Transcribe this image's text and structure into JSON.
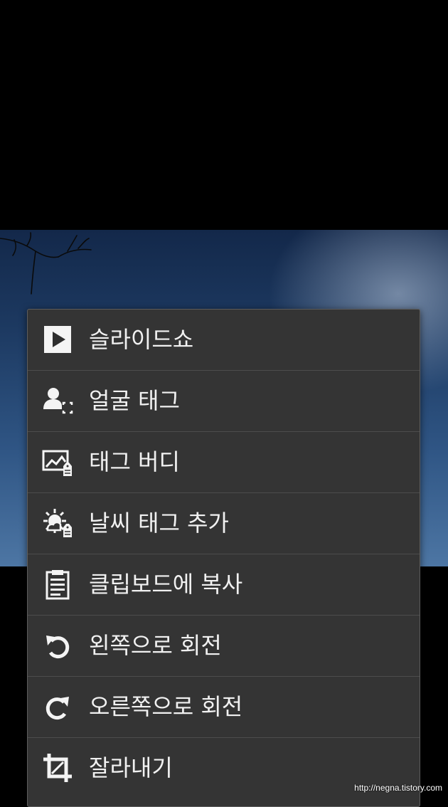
{
  "photo": {
    "sky_color": "#2a4f7e"
  },
  "context_menu": {
    "items": [
      {
        "label": "슬라이드쇼",
        "icon": "play-icon"
      },
      {
        "label": "얼굴 태그",
        "icon": "face-tag-icon"
      },
      {
        "label": "태그 버디",
        "icon": "picture-tag-icon"
      },
      {
        "label": "날씨 태그 추가",
        "icon": "weather-tag-icon"
      },
      {
        "label": "클립보드에 복사",
        "icon": "clipboard-icon"
      },
      {
        "label": "왼쪽으로 회전",
        "icon": "rotate-left-icon"
      },
      {
        "label": "오른쪽으로 회전",
        "icon": "rotate-right-icon"
      },
      {
        "label": "잘라내기",
        "icon": "crop-icon"
      }
    ]
  },
  "watermark": "http://negna.tistory.com"
}
